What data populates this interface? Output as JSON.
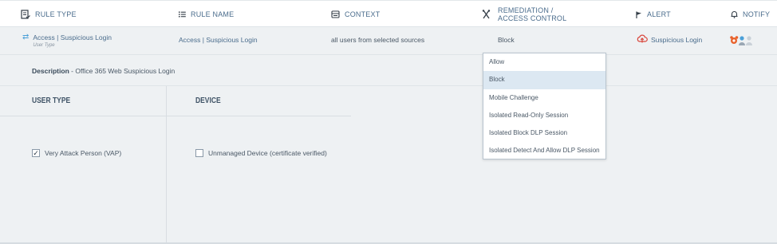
{
  "header": {
    "rule_type": "RULE TYPE",
    "rule_name": "RULE NAME",
    "context": "CONTEXT",
    "remediation_line1": "REMEDIATION /",
    "remediation_line2": "ACCESS CONTROL",
    "alert": "ALERT",
    "notify": "NOTIFY"
  },
  "rule": {
    "type_label": "Access | Suspicious Login",
    "type_sub": "User Type",
    "name": "Access | Suspicious Login",
    "context": "all users from selected sources",
    "remediation": "Block",
    "alert": "Suspicious Login"
  },
  "description": {
    "label": "Description",
    "separator": " - ",
    "value": "Office 365 Web Suspicious Login"
  },
  "panel": {
    "user_type_heading": "USER TYPE",
    "device_heading": "DEVICE",
    "user_type_option": "Very Attack Person (VAP)",
    "user_type_checked": true,
    "device_option": "Unmanaged Device (certificate verified)",
    "device_checked": false
  },
  "dropdown": {
    "options": [
      "Allow",
      "Block",
      "Mobile Challenge",
      "Isolated Read-Only Session",
      "Isolated Block DLP Session",
      "Isolated Detect And Allow DLP Session"
    ],
    "selected_index": 1
  },
  "colors": {
    "header_text": "#4a6c8c",
    "row_bg": "#eef1f3",
    "dropdown_selected": "#dce8f2",
    "link_blue": "#4aa0d8",
    "alert_red": "#d9453a",
    "notify_orange": "#e8622c"
  },
  "icons": {
    "rule_type": "checklist-doc-icon",
    "rule_name": "list-icon",
    "context": "context-card-icon",
    "remediation": "tools-icon",
    "alert": "flag-icon",
    "notify": "bell-icon",
    "rule_type_row": "swap-arrows-icon",
    "alert_row": "cloud-alert-icon",
    "notify_row": "user-avatars-icon"
  }
}
